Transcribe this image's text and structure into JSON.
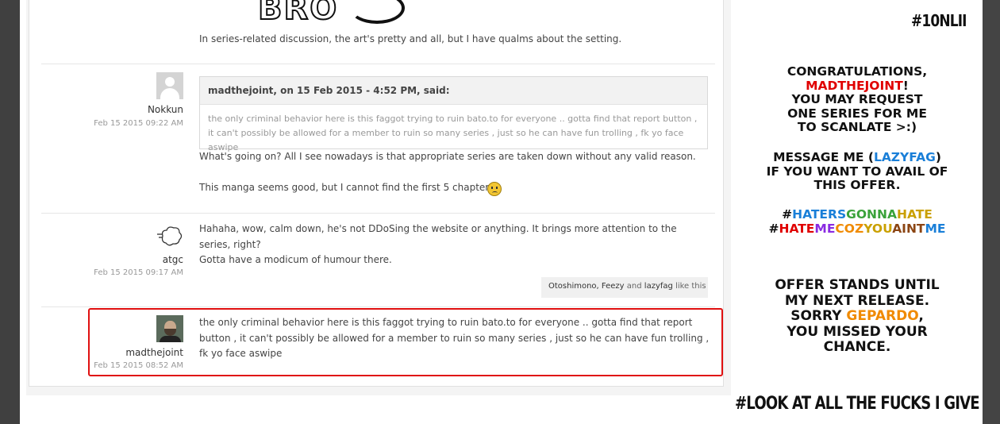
{
  "posts": [
    {
      "text": "In series-related discussion, the art's pretty and all, but I have qualms about the setting."
    },
    {
      "author": "Nokkun",
      "date": "Feb 15 2015 09:22 AM",
      "quote_header": "madthejoint, on 15 Feb 2015 - 4:52 PM, said:",
      "quote_text": "the only criminal behavior here is this faggot trying to ruin bato.to for everyone .. gotta find that report button , it can't possibly be allowed for a member to ruin so many series , just so he can have fun trolling , fk yo face aswipe",
      "text_1": "What's going on? All I see nowadays is that appropriate series are taken down without any valid reason.",
      "text_2": "This manga seems good, but I cannot find the first 5 chapters."
    },
    {
      "author": "atgc",
      "date": "Feb 15 2015 09:17 AM",
      "text_1": "Hahaha, wow, calm down, he's not DDoSing the website or anything. It brings more attention to the series, right?",
      "text_2": "Gotta have a modicum of humour there.",
      "likes_names": "Otoshimono, Feezy",
      "likes_and": "and",
      "likes_last": "lazyfag",
      "likes_suffix": "like this"
    },
    {
      "author": "madthejoint",
      "date": "Feb 15 2015 08:52 AM",
      "text": "the only criminal behavior here is this faggot trying to ruin bato.to for everyone .. gotta find that report button , it can't possibly be allowed for a member to ruin so many series , just so he can have fun trolling , fk yo face aswipe"
    }
  ],
  "side": {
    "hashtag_top": "#10NLII",
    "congrats": "CONGRATULATIONS,",
    "winner": "MADTHEJOINT",
    "bang": "!",
    "l2": "YOU MAY REQUEST",
    "l3": "ONE SERIES FOR ME",
    "l4": "TO SCANLATE >:)",
    "m1a": "MESSAGE ME (",
    "m1b": "LAZYFAG",
    "m1c": ")",
    "m2": "IF YOU WANT TO AVAIL OF",
    "m3": "THIS OFFER.",
    "tag1": [
      "#",
      "HATERS",
      "GONNA",
      "HATE"
    ],
    "tag2": [
      "#",
      "HATE",
      "ME",
      "COZ",
      "YOU",
      "AINT",
      "ME"
    ],
    "o1": "OFFER STANDS UNTIL",
    "o2": "MY NEXT RELEASE.",
    "o3a": "SORRY ",
    "o3b": "GEPARDO",
    "o3c": ",",
    "o4": "YOU MISSED YOUR",
    "o5": "CHANCE.",
    "hashtag_bottom": "#LOOK AT ALL THE FUCKS I GIVE"
  },
  "logo_text": "BRO"
}
